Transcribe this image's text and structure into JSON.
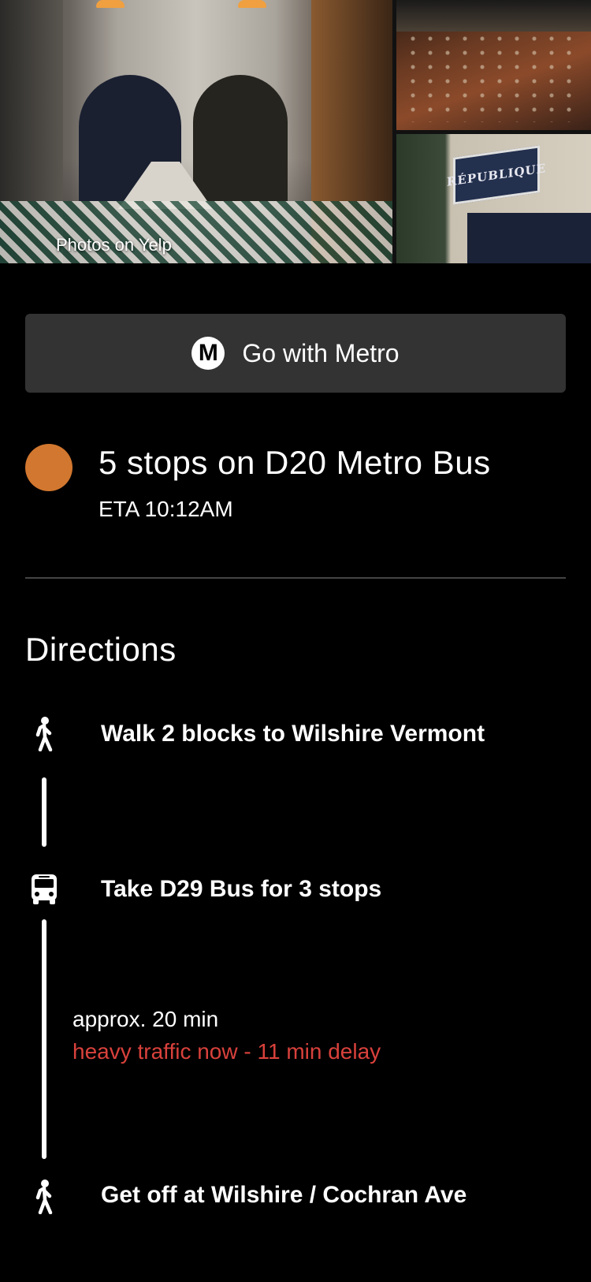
{
  "gallery": {
    "photos_label": "Photos on Yelp",
    "sign_text": "RÉPUBLIQUE"
  },
  "metro": {
    "logo_letter": "M",
    "label": "Go with Metro"
  },
  "route": {
    "title": "5 stops on D20 Metro Bus",
    "eta": "ETA 10:12AM",
    "color": "#d2772f"
  },
  "directions": {
    "heading": "Directions",
    "steps": [
      {
        "icon": "walk-icon",
        "text": "Walk 2 blocks to Wilshire Vermont"
      },
      {
        "icon": "bus-icon",
        "text": "Take D29 Bus for 3 stops"
      },
      {
        "icon": "walk-icon",
        "text": "Get off at Wilshire / Cochran Ave"
      }
    ],
    "segment": {
      "approx": "approx. 20 min",
      "delay": "heavy traffic now - 11 min delay",
      "delay_color": "#d9413c"
    }
  }
}
